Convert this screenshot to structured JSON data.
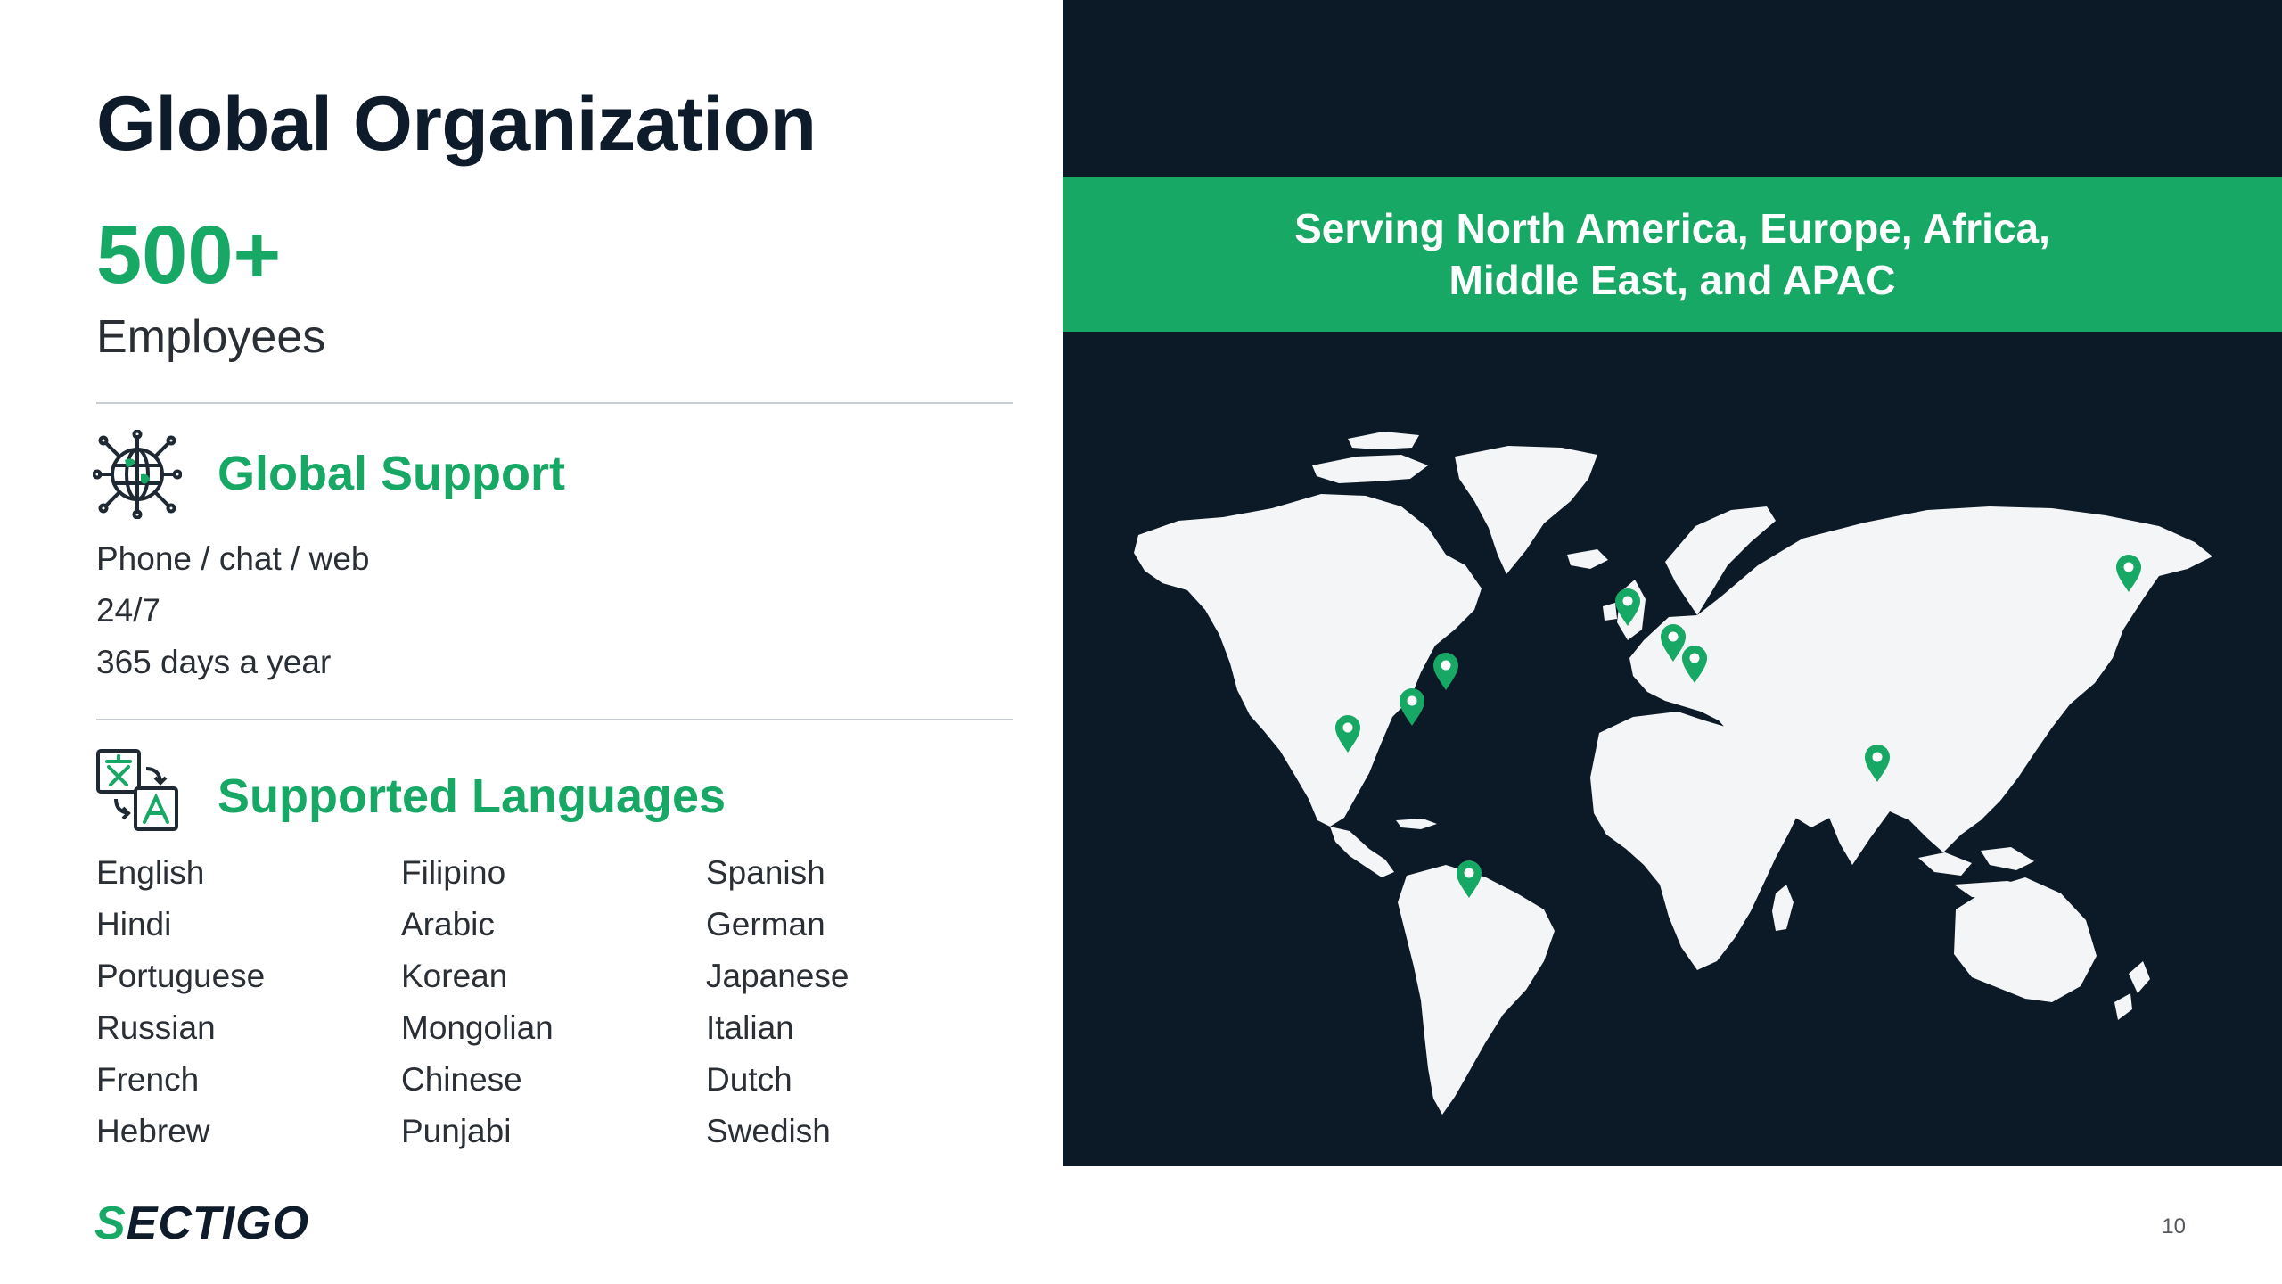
{
  "slide": {
    "title": "Global Organization",
    "page_number": "10"
  },
  "stats": {
    "value": "500+",
    "label": "Employees"
  },
  "support": {
    "heading": "Global Support",
    "icon": "globe-network-icon",
    "lines": [
      "Phone / chat / web",
      "24/7",
      "365 days a year"
    ]
  },
  "languages": {
    "heading": "Supported Languages",
    "icon": "translate-icon",
    "items": [
      "English",
      "Filipino",
      "Spanish",
      "Hindi",
      "Arabic",
      "German",
      "Portuguese",
      "Korean",
      "Japanese",
      "Russian",
      "Mongolian",
      "Italian",
      "French",
      "Chinese",
      "Dutch",
      "Hebrew",
      "Punjabi",
      "Swedish"
    ]
  },
  "map": {
    "banner_text": "Serving North America, Europe, Africa, Middle East, and APAC",
    "marker_icon": "location-pin-icon",
    "colors": {
      "background": "#0c1927",
      "land": "#f4f5f6",
      "accent": "#16a864"
    }
  },
  "brand": {
    "logo_first": "S",
    "logo_rest": "ECTIGO",
    "accent_color": "#16a864",
    "text_color": "#0d1b2a"
  }
}
